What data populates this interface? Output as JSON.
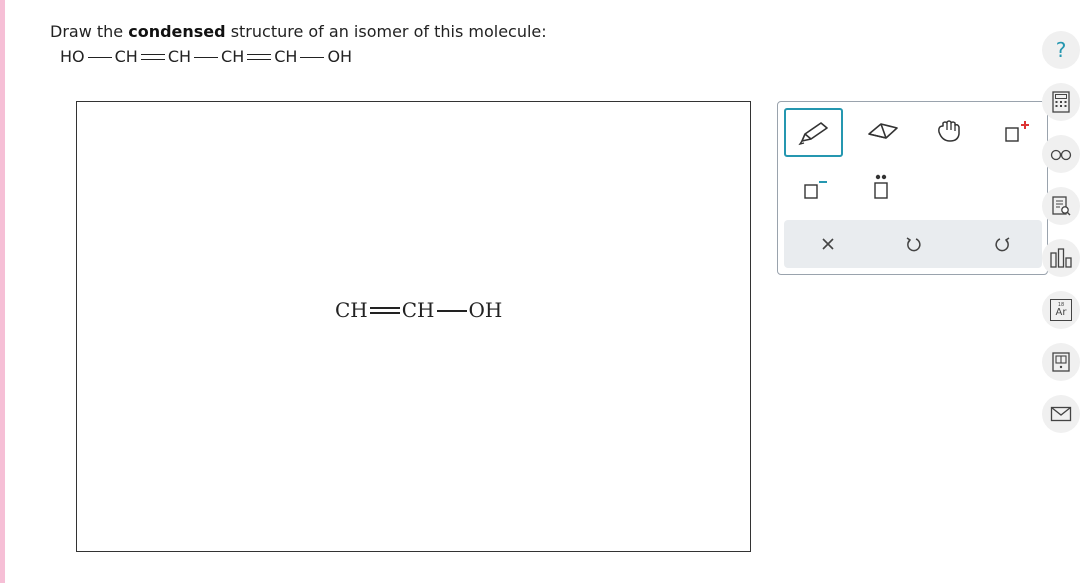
{
  "prompt": {
    "before": "Draw the ",
    "bold": "condensed",
    "after": " structure of an isomer of this molecule:"
  },
  "molecule": {
    "groups": [
      "HO",
      "CH",
      "CH",
      "CH",
      "CH",
      "OH"
    ],
    "bonds": [
      "single",
      "double",
      "single",
      "double",
      "single"
    ]
  },
  "answer": {
    "groups": [
      "CH",
      "CH",
      "OH"
    ],
    "bonds": [
      "double",
      "single"
    ]
  },
  "toolbar": {
    "tools": [
      "pencil-icon",
      "eraser-icon",
      "hand-icon",
      "add-charge-icon",
      "remove-charge-icon",
      "lone-pair-icon"
    ],
    "actions": [
      "clear-icon",
      "undo-icon",
      "redo-icon"
    ]
  },
  "sidebar": {
    "help_label": "?",
    "periodic_number": "18",
    "periodic_symbol": "Ar"
  },
  "colors": {
    "accent": "#2597b0",
    "stripe": "#f6bfd6"
  }
}
